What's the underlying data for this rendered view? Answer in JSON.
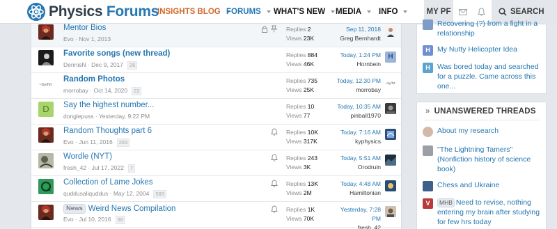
{
  "header": {
    "logo_physics": "Physics",
    "logo_forums": "Forums",
    "nav": [
      "INSIGHTS BLOG",
      "FORUMS",
      "WHAT'S NEW",
      "MEDIA",
      "INFO"
    ],
    "mypf": "MY PF",
    "search": "SEARCH",
    "colors": {
      "insights": "#d16a2c",
      "active": "#2577b1",
      "brand_dark": "#2f3d4a"
    }
  },
  "threads": [
    {
      "title": "Mentor Bios",
      "author": "Evo",
      "date": "Nov 1, 2013",
      "pages": "",
      "replies": "2",
      "views": "23K",
      "last_date": "Sep 11, 2018",
      "last_user": "Greg Bernhardt",
      "icons": "lock-pin",
      "sticky": true
    },
    {
      "title": "Favorite songs (new thread)",
      "author": "DennisN",
      "date": "Dec 9, 2017",
      "pages": "26",
      "replies": "884",
      "views": "46K",
      "last_date": "Today, 1:24 PM",
      "last_user": "Hornbein",
      "bold": true
    },
    {
      "title": "Random Photos",
      "author": "morrobay",
      "date": "Oct 14, 2020",
      "pages": "22",
      "replies": "735",
      "views": "25K",
      "last_date": "Today, 12:30 PM",
      "last_user": "morrobay",
      "bold": true
    },
    {
      "title": "Say the highest number...",
      "author": "donglepuss",
      "date": "Yesterday, 9:22 PM",
      "pages": "",
      "replies": "10",
      "views": "77",
      "last_date": "Today, 10:35 AM",
      "last_user": "pinball1970"
    },
    {
      "title": "Random Thoughts part 6",
      "author": "Evo",
      "date": "Jun 11, 2016",
      "pages": "283",
      "replies": "10K",
      "views": "317K",
      "last_date": "Today, 7:16 AM",
      "last_user": "kyphysics",
      "icons": "bell"
    },
    {
      "title": "Wordle (NYT)",
      "author": "fresh_42",
      "date": "Jul 17, 2022",
      "pages": "7",
      "replies": "243",
      "views": "3K",
      "last_date": "Today, 5:51 AM",
      "last_user": "Orodruin",
      "icons": "bell"
    },
    {
      "title": "Collection of Lame Jokes",
      "author": "quddusaliquddus",
      "date": "May 12, 2004",
      "pages": "583",
      "replies": "13K",
      "views": "2M",
      "last_date": "Today, 4:48 AM",
      "last_user": "Hamiltonian",
      "icons": "bell"
    },
    {
      "title": "Weird News Compilation",
      "tag": "News",
      "author": "Evo",
      "date": "Jul 10, 2016",
      "pages": "36",
      "replies": "1K",
      "views": "70K",
      "last_date": "Yesterday, 7:28 PM",
      "last_user": "fresh_42",
      "icons": "bell"
    }
  ],
  "labels": {
    "replies": "Replies",
    "views": "Views",
    "dot": " · "
  },
  "sidebar_latest": [
    {
      "text": "Recovering (?) from a fight in a relationship"
    },
    {
      "text": "My Nutty Helicopter Idea",
      "avatar": "H"
    },
    {
      "text": "Was bored today and searched for a puzzle. Came across this one...",
      "avatar": "H"
    }
  ],
  "sidebar_unanswered": {
    "heading": "UNANSWERED THREADS",
    "items": [
      {
        "text": "About my research"
      },
      {
        "text": "\"The Lightning Tamers\" (Nonfiction history of science book)"
      },
      {
        "text": "Chess and Ukraine"
      },
      {
        "tag": "MHB",
        "text": "Need to revise, nothing entering my brain after studying for few hrs today",
        "avatar": "V"
      }
    ]
  }
}
